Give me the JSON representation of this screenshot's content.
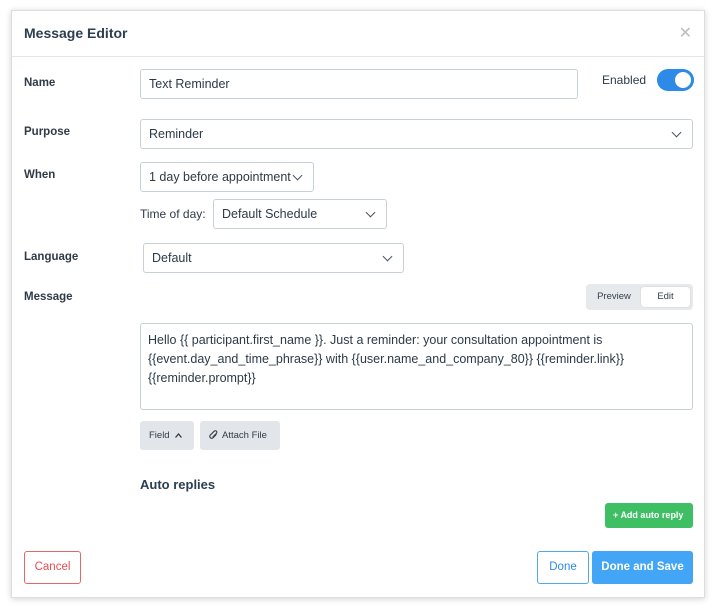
{
  "dialog": {
    "title": "Message Editor",
    "close_icon": "close-icon"
  },
  "name": {
    "label": "Name",
    "value": "Text Reminder"
  },
  "enabled": {
    "label": "Enabled",
    "on": true,
    "color": "#2d8ae6"
  },
  "purpose": {
    "label": "Purpose",
    "value": "Reminder"
  },
  "when": {
    "label": "When",
    "value": "1 day before appointment",
    "time_of_day_label": "Time of day:",
    "time_of_day_value": "Default Schedule"
  },
  "language": {
    "label": "Language",
    "value": "Default"
  },
  "message": {
    "label": "Message",
    "modes": [
      "Preview",
      "Edit"
    ],
    "active_mode": "Edit",
    "text": "Hello {{ participant.first_name }}. Just a reminder: your consultation appointment is {{event.day_and_time_phrase}} with {{user.name_and_company_80}} {{reminder.link}} {{reminder.prompt}}"
  },
  "toolbar": {
    "field_label": "Field",
    "attach_label": "Attach File",
    "chevron_icon": "chevron-up-icon",
    "attach_icon": "paperclip-icon"
  },
  "auto_replies": {
    "title": "Auto replies",
    "add_label": "Add auto reply",
    "add_color": "#3fbf63"
  },
  "footer": {
    "cancel_label": "Cancel",
    "done_label": "Done",
    "done_save_label": "Done and Save",
    "primary_color": "#42a5f5",
    "danger_color": "#e24f52"
  }
}
